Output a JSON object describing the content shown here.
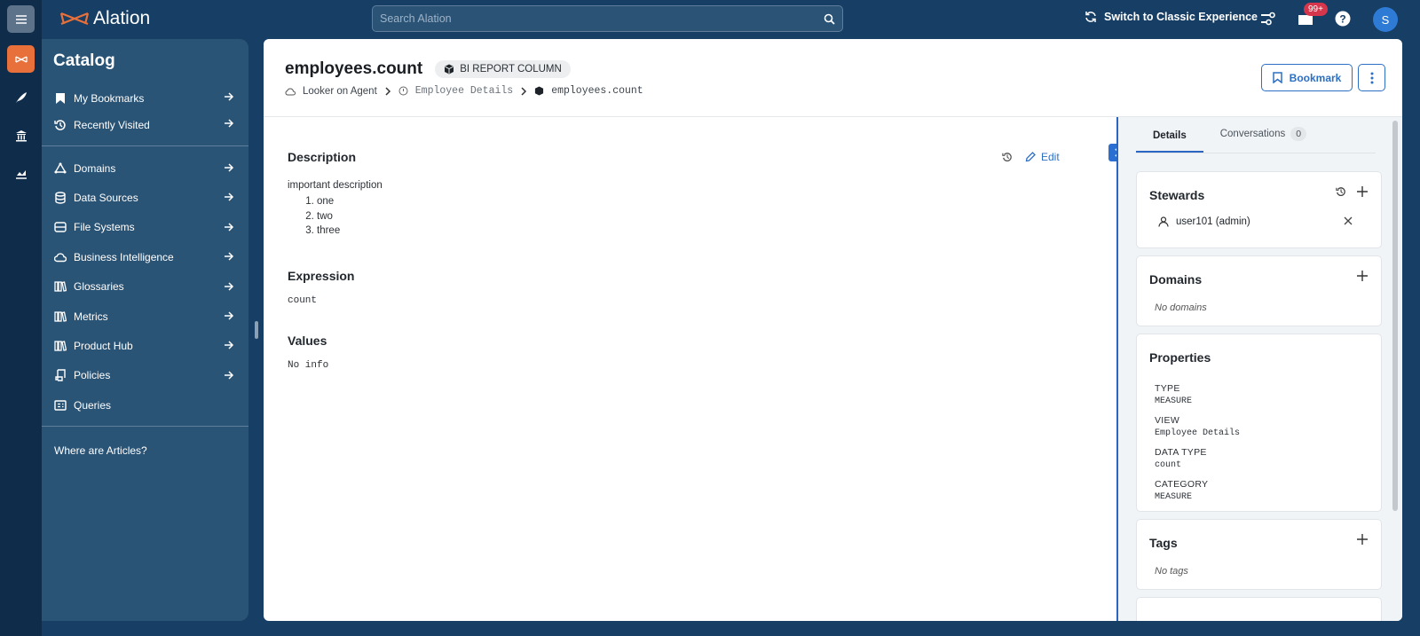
{
  "app": {
    "logo_text": "Alation",
    "search_placeholder": "Search Alation",
    "switch_label": "Switch to Classic Experience",
    "notifications_badge": "99+",
    "avatar_initial": "S"
  },
  "catalog": {
    "title": "Catalog",
    "top_items": [
      {
        "label": "My Bookmarks",
        "icon": "bookmark-icon"
      },
      {
        "label": "Recently Visited",
        "icon": "history-icon"
      }
    ],
    "items": [
      {
        "label": "Domains",
        "icon": "domains-icon",
        "arrow": true
      },
      {
        "label": "Data Sources",
        "icon": "database-icon",
        "arrow": true
      },
      {
        "label": "File Systems",
        "icon": "drive-icon",
        "arrow": true
      },
      {
        "label": "Business Intelligence",
        "icon": "cloud-icon",
        "arrow": true
      },
      {
        "label": "Glossaries",
        "icon": "books-icon",
        "arrow": true
      },
      {
        "label": "Metrics",
        "icon": "books-icon",
        "arrow": true
      },
      {
        "label": "Product Hub",
        "icon": "books-icon",
        "arrow": true
      },
      {
        "label": "Policies",
        "icon": "scroll-icon",
        "arrow": true
      },
      {
        "label": "Queries",
        "icon": "query-icon",
        "arrow": false
      }
    ],
    "footer_link": "Where are Articles?"
  },
  "page": {
    "title": "employees.count",
    "type_chip": "BI REPORT COLUMN",
    "breadcrumbs": [
      "Looker on Agent",
      "Employee Details",
      "employees.count"
    ],
    "bookmark_label": "Bookmark",
    "edit_label": "Edit"
  },
  "main": {
    "description": {
      "heading": "Description",
      "text": "important description",
      "list": [
        "one",
        "two",
        "three"
      ]
    },
    "expression": {
      "heading": "Expression",
      "value": "count"
    },
    "values": {
      "heading": "Values",
      "value": "No info"
    }
  },
  "right_panel": {
    "tabs": [
      {
        "label": "Details",
        "active": true
      },
      {
        "label": "Conversations",
        "count": "0"
      }
    ],
    "stewards": {
      "heading": "Stewards",
      "users": [
        "user101 (admin)"
      ]
    },
    "domains": {
      "heading": "Domains",
      "empty": "No domains"
    },
    "properties": {
      "heading": "Properties",
      "items": [
        {
          "key": "TYPE",
          "value": "MEASURE"
        },
        {
          "key": "VIEW",
          "value": "Employee Details"
        },
        {
          "key": "DATA TYPE",
          "value": "count"
        },
        {
          "key": "CATEGORY",
          "value": "MEASURE"
        }
      ]
    },
    "tags": {
      "heading": "Tags",
      "empty": "No tags"
    }
  },
  "colors": {
    "brand_orange": "#e8703a",
    "nav_blue": "#173e64",
    "accent_blue": "#2d6fc4",
    "badge_red": "#d6364c"
  }
}
